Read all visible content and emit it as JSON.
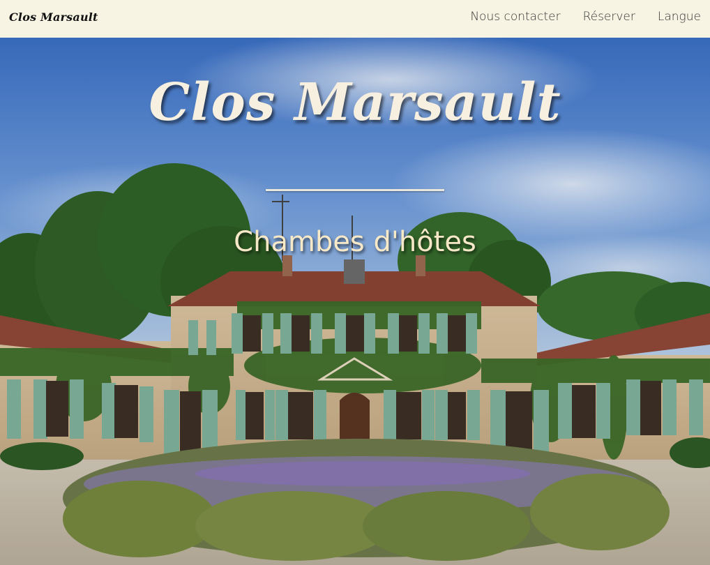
{
  "nav": {
    "brand": "Clos Marsault",
    "items": [
      {
        "label": "Nous contacter"
      },
      {
        "label": "Réserver"
      },
      {
        "label": "Langue"
      }
    ]
  },
  "hero": {
    "title": "Clos Marsault",
    "subtitle": "Chambes d'hôtes"
  },
  "colors": {
    "nav_background": "#f7f4e3",
    "title_text": "#f7efdf",
    "subtitle_text": "#f7e9c8",
    "sky": "#3f77c9",
    "shutters": "#7fb19c"
  }
}
